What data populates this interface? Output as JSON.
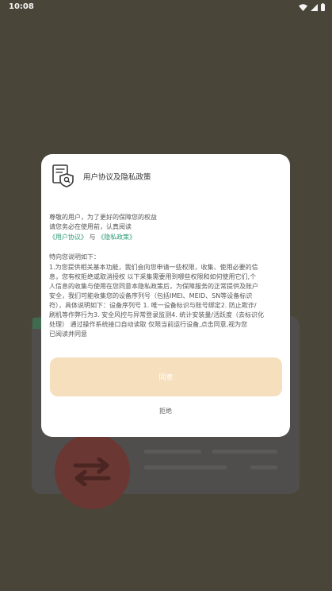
{
  "status_bar": {
    "time": "10:08"
  },
  "dialog": {
    "title": "用户协议及隐私政策",
    "greeting": "尊敬的用户，为了更好的保障您的权益",
    "read_prompt": "请您务必在使用前，认真阅读",
    "user_agreement_link": "《用户协议》",
    "and_word": "与",
    "privacy_policy_link": "《隐私政策》",
    "notice_heading": "特向您说明如下：",
    "notice_lines": [
      "1.为您提供相关基本功能，我们会向您申请一些权限，收集、使用必要的信",
      "息，您有权拒绝或取消授权 以下采集需要用到哪些权限和如何使用它们,个",
      "人信息的收集与使用在您同意本隐私政策后，为保障服务的正常提供及账户",
      "安全，我们可能收集您的设备序列号（包括IMEI、MEID、SN等设备标识",
      "符），具体说明如下：设备序列号    1. 唯一设备标识与账号绑定2. 防止欺诈/",
      "刷机等作弊行为3. 安全风控与异常登录监测4. 统计安装量/活跃度（去标识化",
      "处理）     通过操作系统接口自动读取      仅限当前运行设备,点击同意,视为您",
      "已阅读并同意"
    ],
    "agree_label": "同意",
    "reject_label": "拒绝"
  },
  "colors": {
    "accent": "#f5dfbd",
    "link": "#2f9b79",
    "overlay_bg": "#4a4539"
  }
}
